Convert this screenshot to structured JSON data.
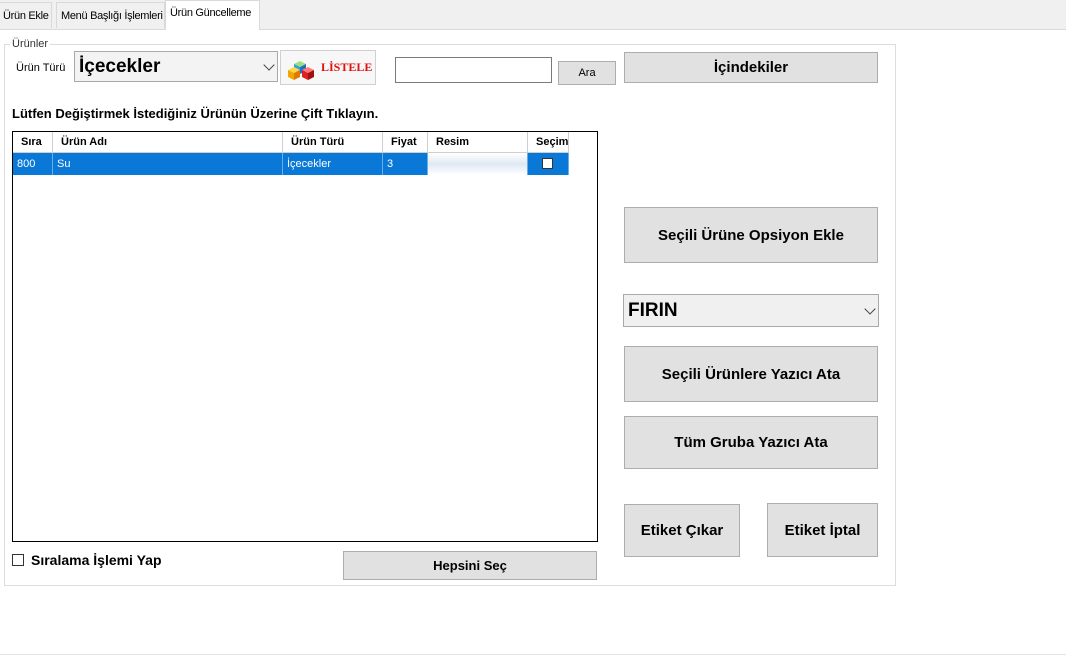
{
  "tabs": [
    {
      "label": "Ürün Ekle"
    },
    {
      "label": "Menü Başlığı İşlemleri"
    },
    {
      "label": "Ürün Güncelleme"
    }
  ],
  "group": {
    "legend": "Ürünler"
  },
  "filter": {
    "type_label": "Ürün Türü",
    "type_value": "İçecekler",
    "list_button": "LİSTELE",
    "search_value": "",
    "search_button": "Ara"
  },
  "instruction": "Lütfen Değiştirmek İstediğiniz Ürünün Üzerine Çift Tıklayın.",
  "grid": {
    "columns": [
      "Sıra",
      "Ürün Adı",
      "Ürün Türü",
      "Fiyat",
      "Resim",
      "Seçim"
    ],
    "rows": [
      {
        "sira": "800",
        "urun_adi": "Su",
        "urun_turu": "İçecekler",
        "fiyat": "3",
        "secim": false
      }
    ]
  },
  "sort_checkbox": {
    "label": "Sıralama İşlemi Yap",
    "checked": false
  },
  "buttons": {
    "select_all": "Hepsini Seç",
    "ingredients": "İçindekiler",
    "add_option": "Seçili Ürüne Opsiyon Ekle",
    "assign_printer_selected": "Seçili Ürünlere Yazıcı Ata",
    "assign_printer_group": "Tüm Gruba Yazıcı Ata",
    "print_label": "Etiket Çıkar",
    "cancel_label": "Etiket İptal"
  },
  "printer_select": {
    "value": "FIRIN"
  },
  "colors": {
    "selection": "#0a78d7",
    "button_bg": "#e1e1e1",
    "logo_red": "#e01010"
  }
}
